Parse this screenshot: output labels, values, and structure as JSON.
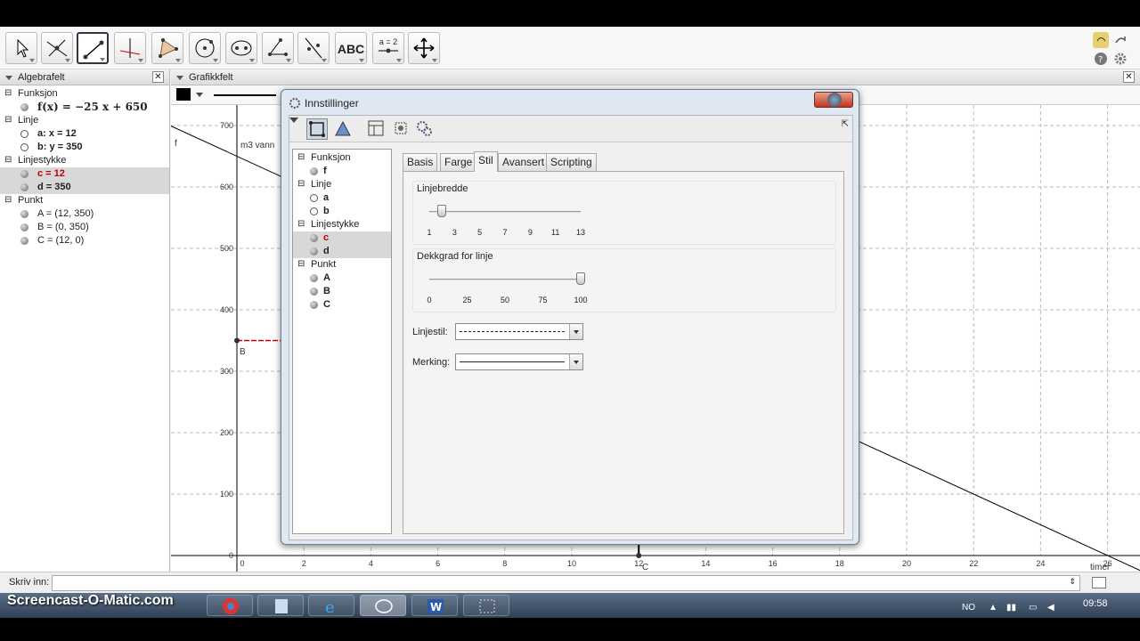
{
  "toolbar": {
    "tools": [
      "move-tool",
      "point-tool",
      "segment-tool",
      "perpendicular-line-tool",
      "polygon-tool",
      "circle-tool",
      "conic-tool",
      "angle-tool",
      "reflect-tool",
      "text-tool",
      "slider-tool",
      "move-view-tool"
    ],
    "text_tool_label": "ABC",
    "slider_tool_label": "a = 2"
  },
  "algebra": {
    "title": "Algebrafelt",
    "groups": [
      {
        "label": "Funksjon",
        "items": [
          {
            "text": "f(x) = −25 x + 650"
          }
        ]
      },
      {
        "label": "Linje",
        "items": [
          {
            "text": "a: x = 12"
          },
          {
            "text": "b: y = 350"
          }
        ]
      },
      {
        "label": "Linjestykke",
        "items": [
          {
            "text": "c = 12"
          },
          {
            "text": "d = 350"
          }
        ]
      },
      {
        "label": "Punkt",
        "items": [
          {
            "text": "A = (12, 350)"
          },
          {
            "text": "B = (0, 350)"
          },
          {
            "text": "C = (12, 0)"
          }
        ]
      }
    ]
  },
  "graphics": {
    "title": "Grafikkfelt",
    "y_axis_label": "m3 vann",
    "x_axis_label": "timer",
    "function_label": "f",
    "point_b_label": "B",
    "point_c_label": "C",
    "y_ticks": [
      "700",
      "600",
      "500",
      "400",
      "300",
      "200",
      "100",
      "0"
    ],
    "x_ticks": [
      "0",
      "2",
      "4",
      "6",
      "8",
      "10",
      "12",
      "14",
      "16",
      "18",
      "20",
      "22",
      "24",
      "26"
    ]
  },
  "input_bar": {
    "label": "Skriv inn:"
  },
  "dialog": {
    "title": "Innstillinger",
    "tree": [
      {
        "label": "Funksjon",
        "items": [
          "f"
        ]
      },
      {
        "label": "Linje",
        "items": [
          "a",
          "b"
        ]
      },
      {
        "label": "Linjestykke",
        "items": [
          "c",
          "d"
        ]
      },
      {
        "label": "Punkt",
        "items": [
          "A",
          "B",
          "C"
        ]
      }
    ],
    "tabs": [
      "Basis",
      "Farge",
      "Stil",
      "Avansert",
      "Scripting"
    ],
    "active_tab": "Stil",
    "line_thickness": {
      "title": "Linjebredde",
      "ticks": [
        "1",
        "3",
        "5",
        "7",
        "9",
        "11",
        "13"
      ],
      "value": 2
    },
    "line_opacity": {
      "title": "Dekkgrad for linje",
      "ticks": [
        "0",
        "25",
        "50",
        "75",
        "100"
      ],
      "value": 100
    },
    "line_style_label": "Linjestil:",
    "decoration_label": "Merking:"
  },
  "taskbar": {
    "watermark": "Screencast-O-Matic.com",
    "lang": "NO",
    "time": "09:58"
  }
}
